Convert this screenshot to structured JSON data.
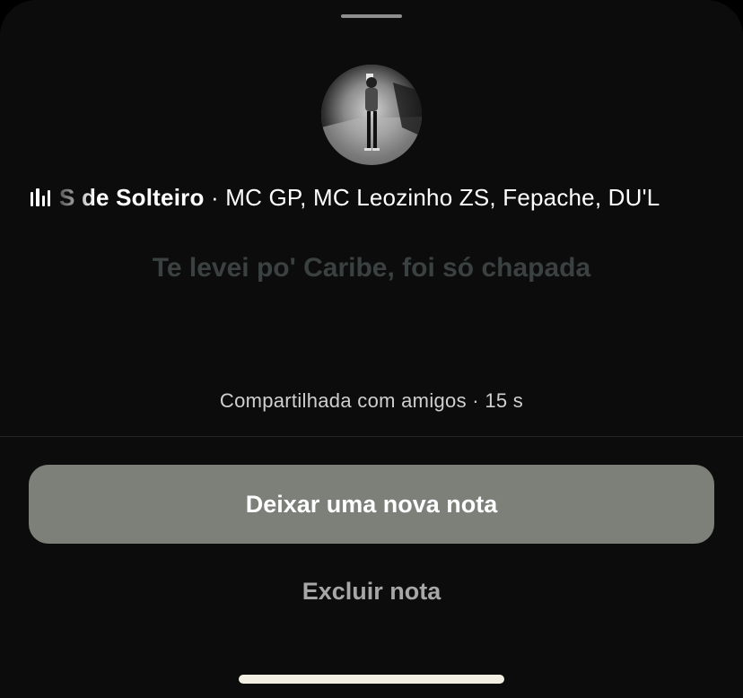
{
  "music": {
    "icon": "equalizer-icon",
    "song_fragment": "S de Solteiro",
    "separator": " · ",
    "artists": "MC GP, MC Leozinho ZS, Fepache, DU'L"
  },
  "note": {
    "lyric": "Te levei po' Caribe, foi só chapada",
    "shared_status": "Compartilhada com amigos · 15 s"
  },
  "actions": {
    "primary_label": "Deixar uma nova nota",
    "secondary_label": "Excluir nota"
  },
  "colors": {
    "background": "#0c0c0c",
    "primary_button": "#7d7f79",
    "lyric_text": "#3a4140",
    "secondary_text": "#a7a7a7"
  }
}
